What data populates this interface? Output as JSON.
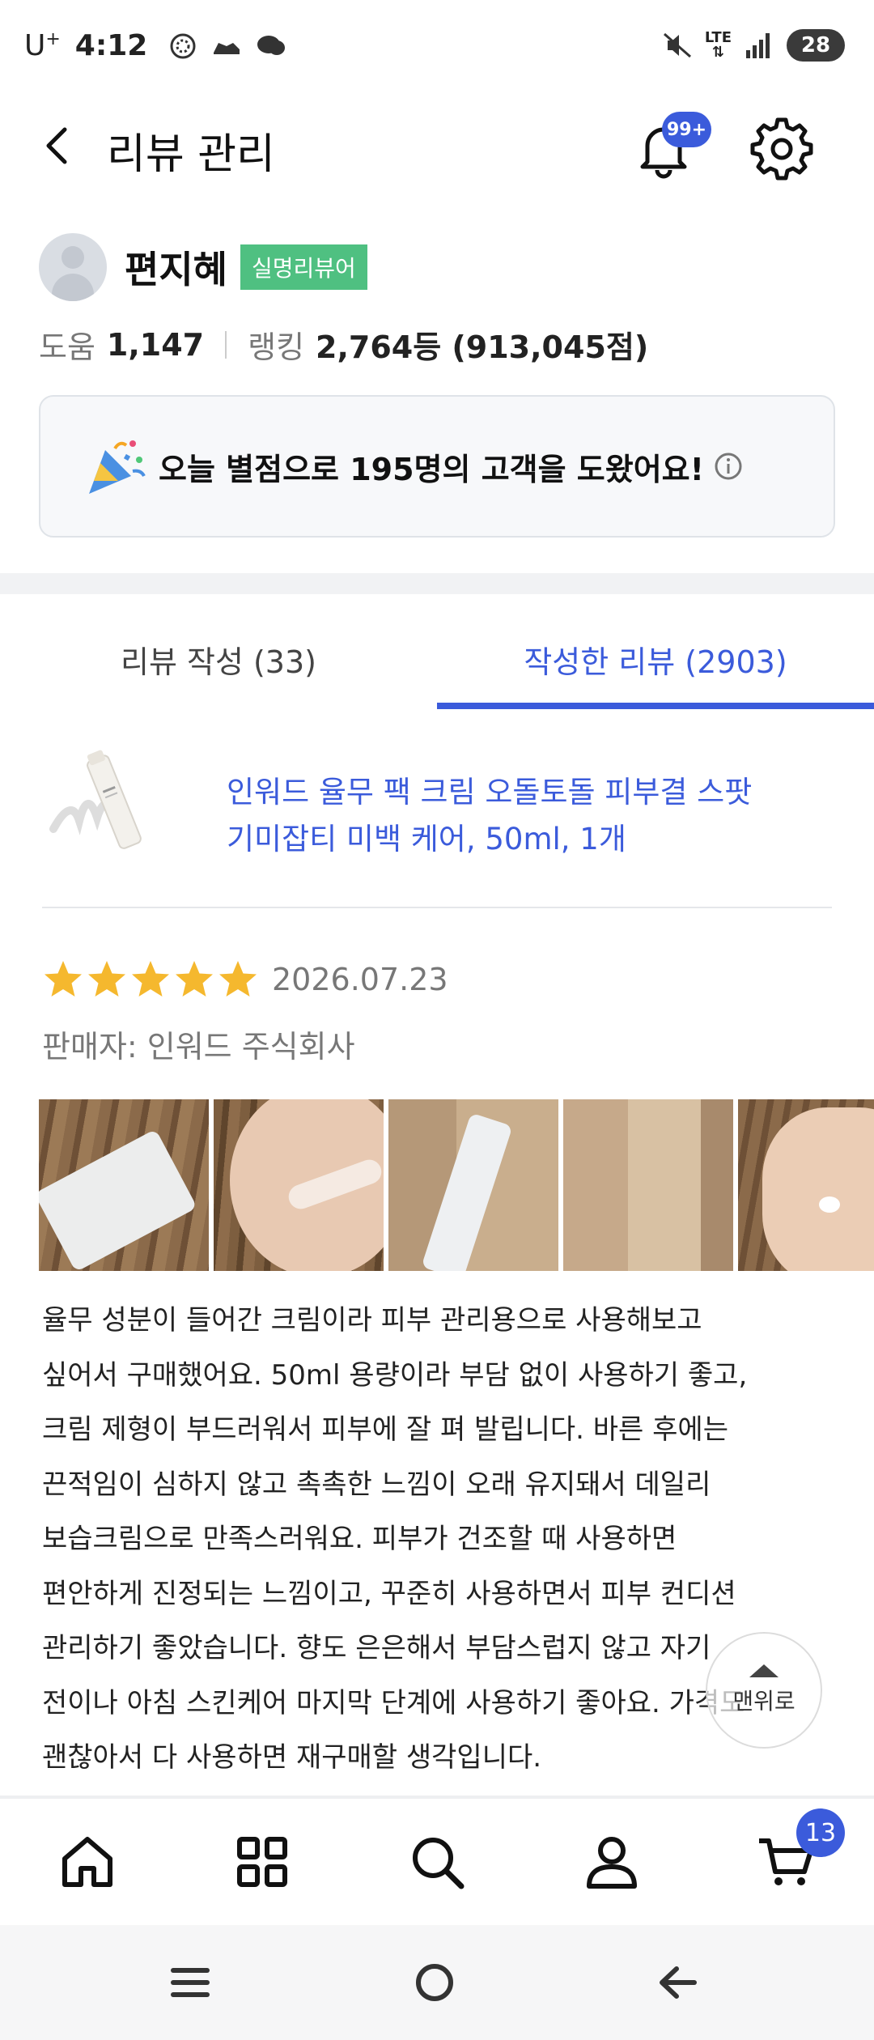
{
  "status_bar": {
    "carrier": "U",
    "carrier_sup": "+",
    "time": "4:12",
    "network": "LTE",
    "battery": "28"
  },
  "header": {
    "title": "리뷰 관리",
    "notification_badge": "99+"
  },
  "profile": {
    "name": "편지혜",
    "badge": "실명리뷰어",
    "help_label": "도움",
    "help_value": "1,147",
    "rank_label": "랭킹",
    "rank_value": "2,764등 (913,045점)"
  },
  "help_card": {
    "text": "오늘 별점으로 195명의 고객을 도왔어요!"
  },
  "tabs": {
    "write": "리뷰 작성 (33)",
    "written": "작성한 리뷰 (2903)",
    "active": "written"
  },
  "product": {
    "title_line1": "인워드 율무 팩 크림 오돌토돌 피부결 스팟",
    "title_line2": "기미잡티 미백 케어, 50ml, 1개"
  },
  "review": {
    "rating": 5,
    "date": "2026.07.23",
    "seller": "판매자: 인워드 주식회사",
    "photo_count": 5,
    "lines": [
      "율무 성분이 들어간 크림이라 피부 관리용으로 사용해보고",
      "싶어서 구매했어요. 50ml 용량이라 부담 없이 사용하기 좋고,",
      "크림 제형이 부드러워서 피부에 잘 펴 발립니다. 바른 후에는",
      "끈적임이 심하지 않고 촉촉한 느낌이 오래 유지돼서 데일리",
      "보습크림으로 만족스러워요. 피부가 건조할 때 사용하면",
      "편안하게 진정되는 느낌이고, 꾸준히 사용하면서 피부 컨디션",
      "관리하기 좋았습니다. 향도 은은해서 부담스럽지 않고 자기",
      "전이나 아침 스킨케어 마지막 단계에 사용하기 좋아요. 가격도",
      "괜찮아서 다 사용하면 재구매할 생각입니다."
    ]
  },
  "scroll_top": {
    "label": "맨위로"
  },
  "bottom_nav": {
    "items": [
      "home-icon",
      "category-icon",
      "search-icon",
      "my-page-icon",
      "cart-icon"
    ],
    "cart_badge": "13"
  },
  "colors": {
    "accent": "#3b5bdb",
    "verified": "#4fc081",
    "star": "#f5b82e"
  }
}
